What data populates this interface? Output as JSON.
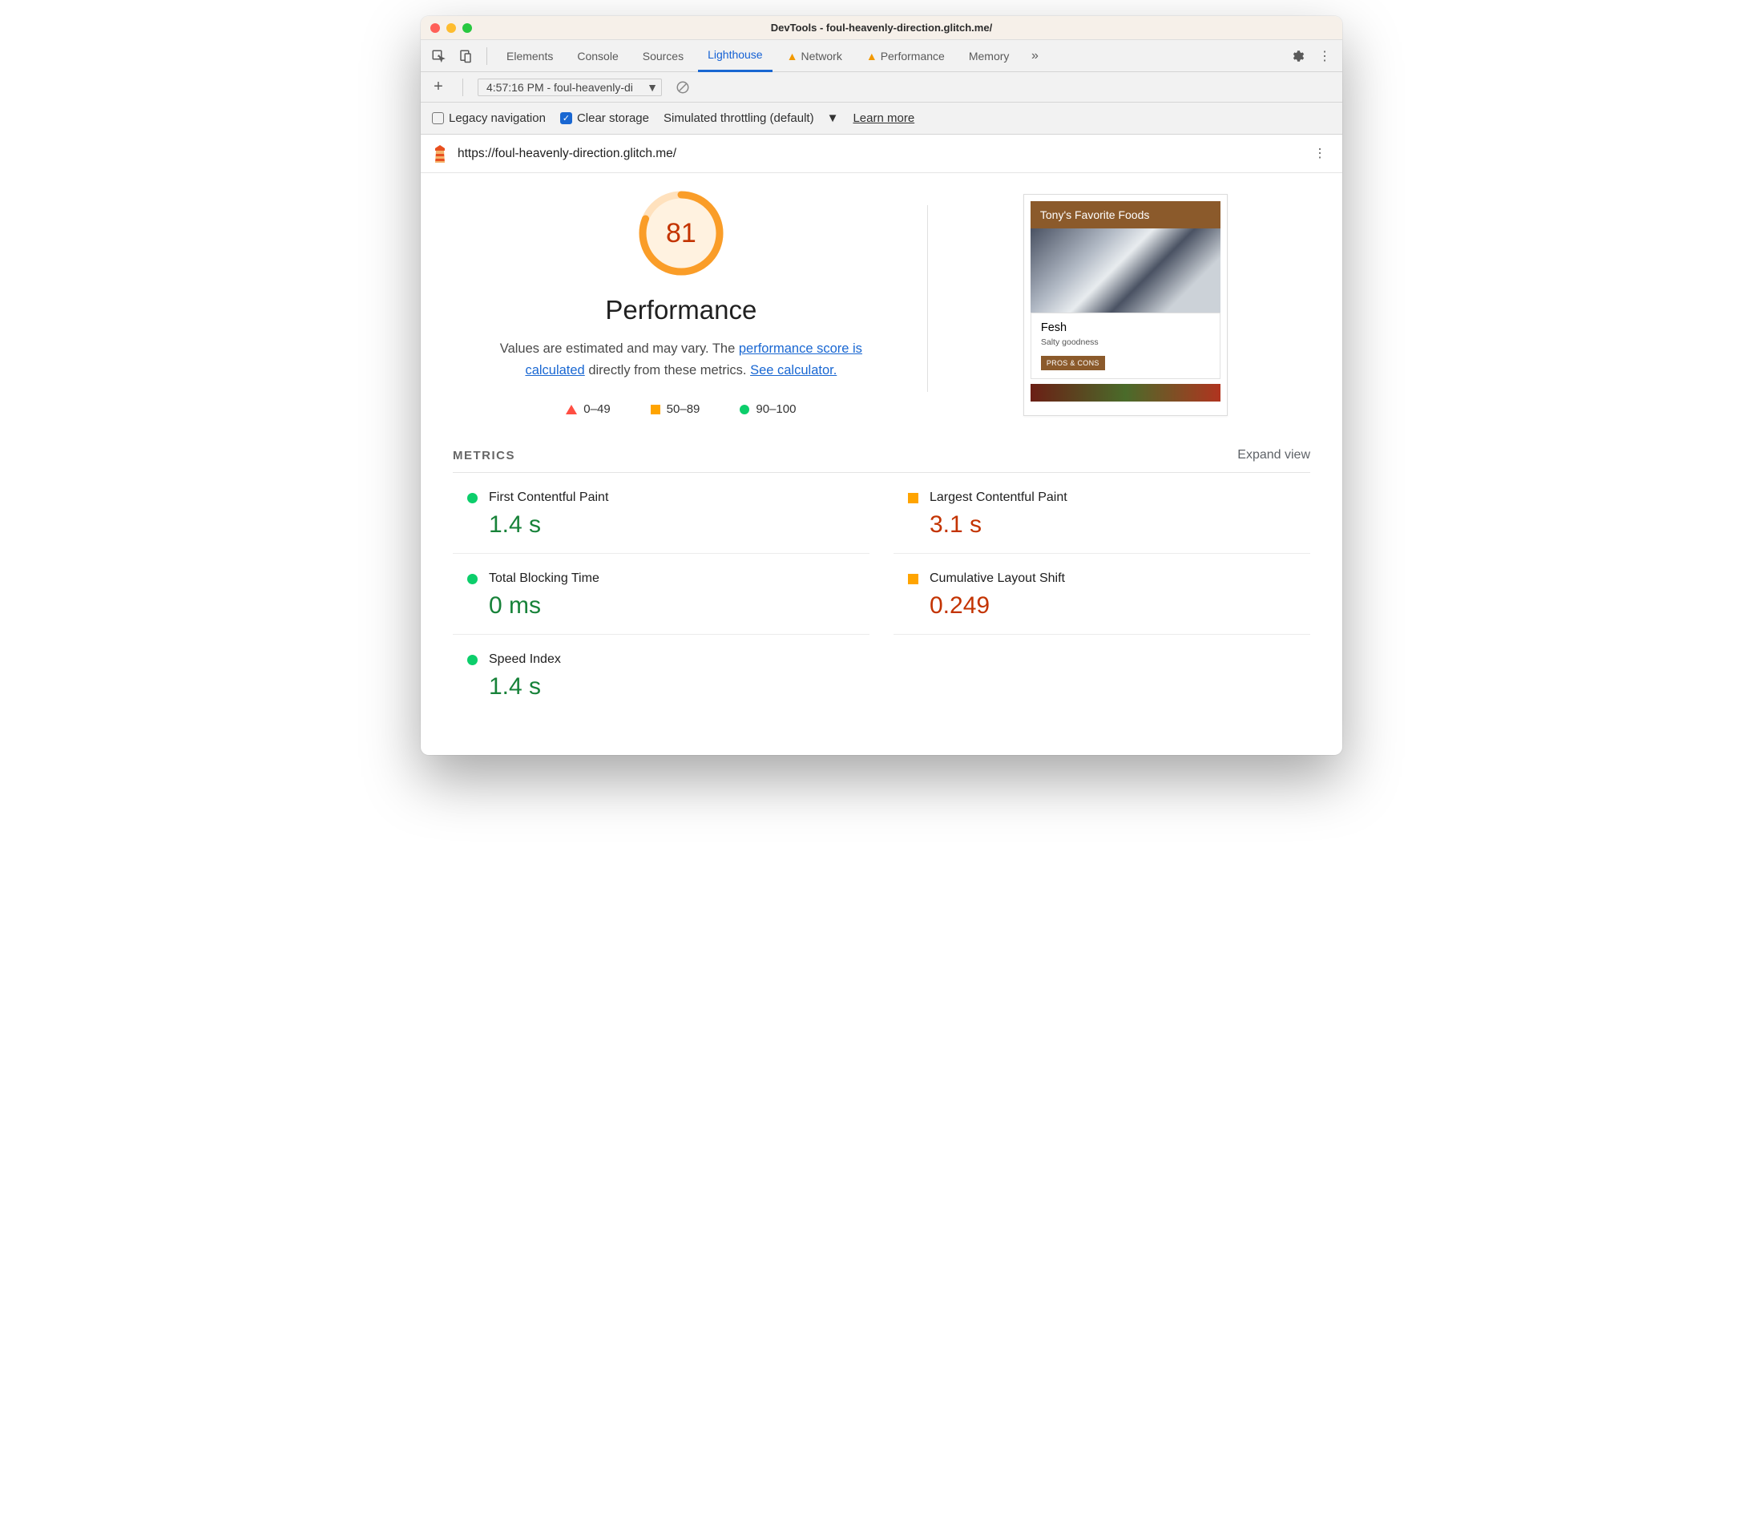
{
  "window": {
    "title": "DevTools - foul-heavenly-direction.glitch.me/"
  },
  "tabs": {
    "elements": "Elements",
    "console": "Console",
    "sources": "Sources",
    "lighthouse": "Lighthouse",
    "network": "Network",
    "performance": "Performance",
    "memory": "Memory"
  },
  "toolbar": {
    "runLabel": "4:57:16 PM - foul-heavenly-di",
    "legacy": "Legacy navigation",
    "clear": "Clear storage",
    "throttle": "Simulated throttling (default)",
    "learn": "Learn more"
  },
  "report": {
    "url": "https://foul-heavenly-direction.glitch.me/",
    "score": "81",
    "title": "Performance",
    "desc_a": "Values are estimated and may vary. The ",
    "desc_link1": "performance score is calculated",
    "desc_b": " directly from these metrics. ",
    "desc_link2": "See calculator.",
    "legend": {
      "low": "0–49",
      "mid": "50–89",
      "high": "90–100"
    }
  },
  "preview": {
    "header": "Tony's Favorite Foods",
    "card_title": "Fesh",
    "card_sub": "Salty goodness",
    "card_btn": "PROS & CONS"
  },
  "chart_data": {
    "type": "table",
    "title": "Lighthouse Performance Metrics",
    "score": 81,
    "metrics": [
      {
        "name": "First Contentful Paint",
        "value": "1.4 s",
        "rating": "good"
      },
      {
        "name": "Largest Contentful Paint",
        "value": "3.1 s",
        "rating": "average"
      },
      {
        "name": "Total Blocking Time",
        "value": "0 ms",
        "rating": "good"
      },
      {
        "name": "Cumulative Layout Shift",
        "value": "0.249",
        "rating": "average"
      },
      {
        "name": "Speed Index",
        "value": "1.4 s",
        "rating": "good"
      }
    ]
  },
  "metrics": {
    "heading": "METRICS",
    "expand": "Expand view",
    "items": [
      {
        "label": "First Contentful Paint",
        "value": "1.4 s",
        "status": "good"
      },
      {
        "label": "Largest Contentful Paint",
        "value": "3.1 s",
        "status": "avg"
      },
      {
        "label": "Total Blocking Time",
        "value": "0 ms",
        "status": "good"
      },
      {
        "label": "Cumulative Layout Shift",
        "value": "0.249",
        "status": "avg"
      },
      {
        "label": "Speed Index",
        "value": "1.4 s",
        "status": "good"
      }
    ]
  }
}
